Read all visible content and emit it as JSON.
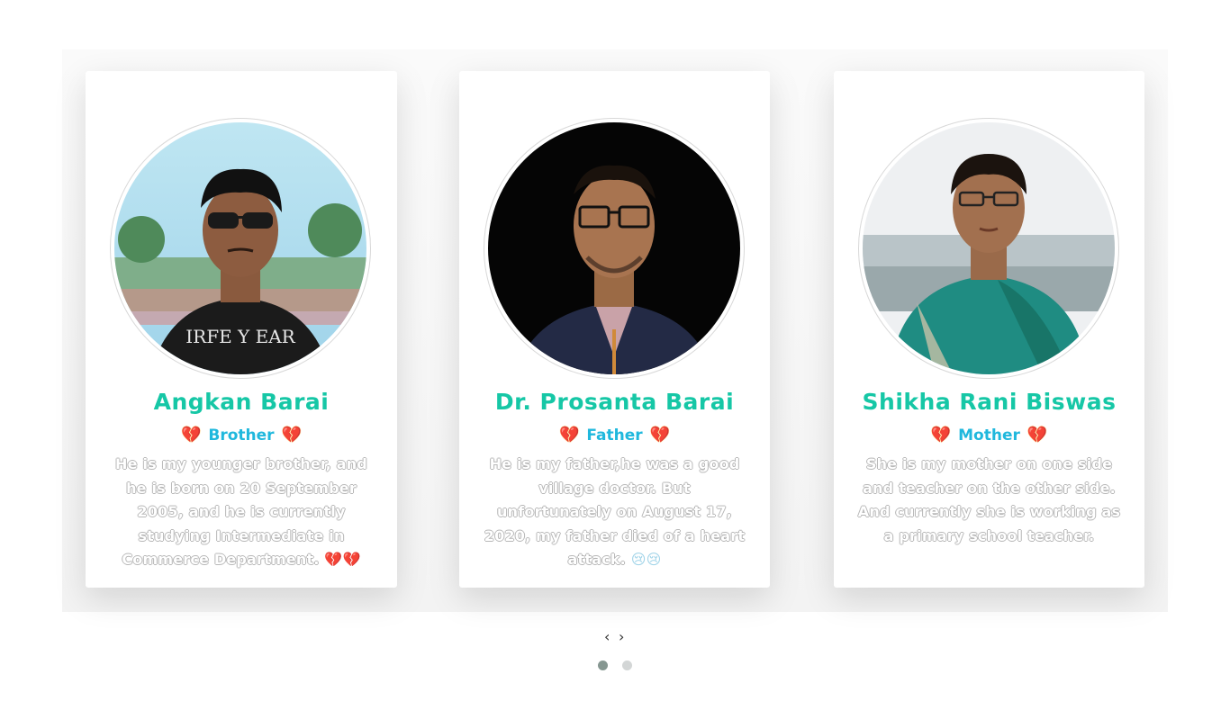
{
  "cards": [
    {
      "name": "Angkan Barai",
      "role": "Brother",
      "description": "He is my younger brother, and he is born on 20 September 2005, and he is currently studying Intermediate in Commerce Department.",
      "emoji": "💔💔"
    },
    {
      "name": "Dr. Prosanta Barai",
      "role": "Father",
      "description": "He is my father,he was a good village doctor. But unfortunately on August 17, 2020, my father died of a heart attack.",
      "emoji": "😢😢"
    },
    {
      "name": "Shikha Rani Biswas",
      "role": "Mother",
      "description": "She is my mother on one side and teacher on the other side. And currently she is working as a primary school teacher.",
      "emoji": ""
    }
  ],
  "role_decoration_icon": "broken-heart-icon",
  "nav": {
    "prev": "‹",
    "next": "›"
  },
  "pagination": {
    "count": 2,
    "active": 1
  },
  "colors": {
    "name": "#16c7a6",
    "role": "#20b8dd",
    "active_dot": "#869791",
    "inactive_dot": "#d3d6d6"
  }
}
